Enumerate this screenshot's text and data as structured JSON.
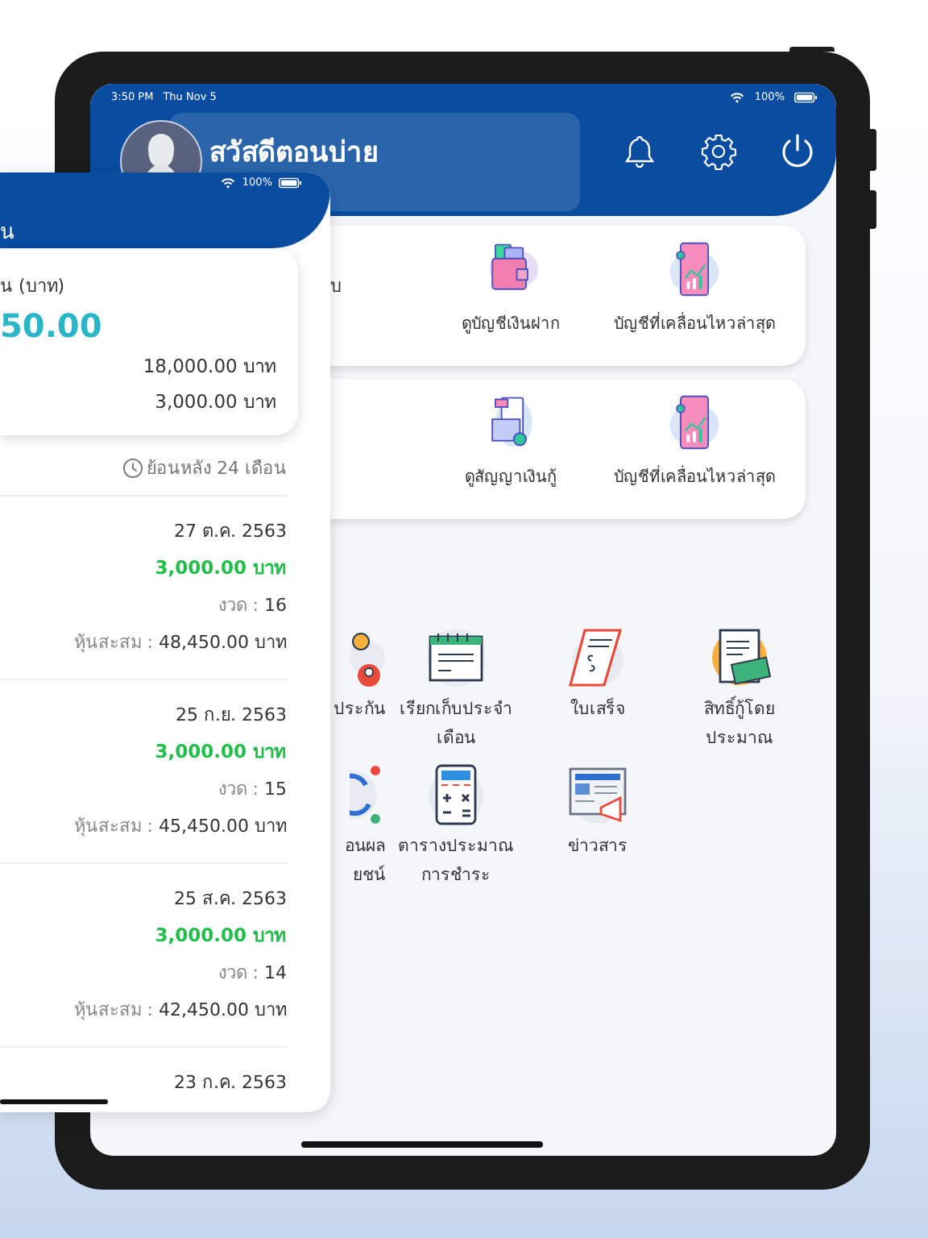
{
  "tablet": {
    "status_bar": {
      "time": "3:50 PM",
      "date": "Thu Nov 5",
      "battery": "100%"
    },
    "header": {
      "greeting": "สวัสดีตอนบ่าย"
    },
    "account_cards": [
      {
        "partial_label": "บ",
        "items": [
          {
            "label": "ดูบัญชีเงินฝาก",
            "kind": "wallet"
          },
          {
            "label": "บัญชีที่เคลื่อนไหวล่าสุด",
            "kind": "phone-chart"
          }
        ]
      },
      {
        "items": [
          {
            "label": "ดูสัญญาเงินกู้",
            "kind": "loan"
          },
          {
            "label": "บัญชีที่เคลื่อนไหวล่าสุด",
            "kind": "phone-chart"
          }
        ]
      }
    ],
    "menu": [
      {
        "lines": [
          "ประกัน"
        ],
        "kind": "insurance"
      },
      {
        "lines": [
          "เรียกเก็บประจำ",
          "เดือน"
        ],
        "kind": "calendar"
      },
      {
        "lines": [
          "ใบเสร็จ"
        ],
        "kind": "receipt"
      },
      {
        "lines": [
          "สิทธิ์กู้โดย",
          "ประมาณ"
        ],
        "kind": "document-money"
      },
      {
        "lines": [
          "อนผล",
          "ยชน์"
        ],
        "kind": "cycle"
      },
      {
        "lines": [
          "ตารางประมาณ",
          "การชำระ"
        ],
        "kind": "calculator"
      },
      {
        "lines": [
          "ข่าวสาร"
        ],
        "kind": "newspaper"
      }
    ]
  },
  "phone": {
    "battery": "100%",
    "title": "น",
    "summary": {
      "label": "น (บาท)",
      "total": "50.00",
      "rows": [
        "18,000.00 บาท",
        "3,000.00 บาท"
      ]
    },
    "history": {
      "filter": "ย้อนหลัง 24 เดือน",
      "entries": [
        {
          "date": "27 ต.ค. 2563",
          "amount": "3,000.00 บาท",
          "installment_label": "งวด :",
          "installment": "16",
          "shares_label": "หุ้นสะสม :",
          "shares": "48,450.00 บาท"
        },
        {
          "date": "25 ก.ย. 2563",
          "amount": "3,000.00 บาท",
          "installment_label": "งวด :",
          "installment": "15",
          "shares_label": "หุ้นสะสม :",
          "shares": "45,450.00 บาท"
        },
        {
          "date": "25 ส.ค. 2563",
          "amount": "3,000.00 บาท",
          "installment_label": "งวด :",
          "installment": "14",
          "shares_label": "หุ้นสะสม :",
          "shares": "42,450.00 บาท"
        },
        {
          "date": "23 ก.ค. 2563"
        }
      ]
    }
  }
}
